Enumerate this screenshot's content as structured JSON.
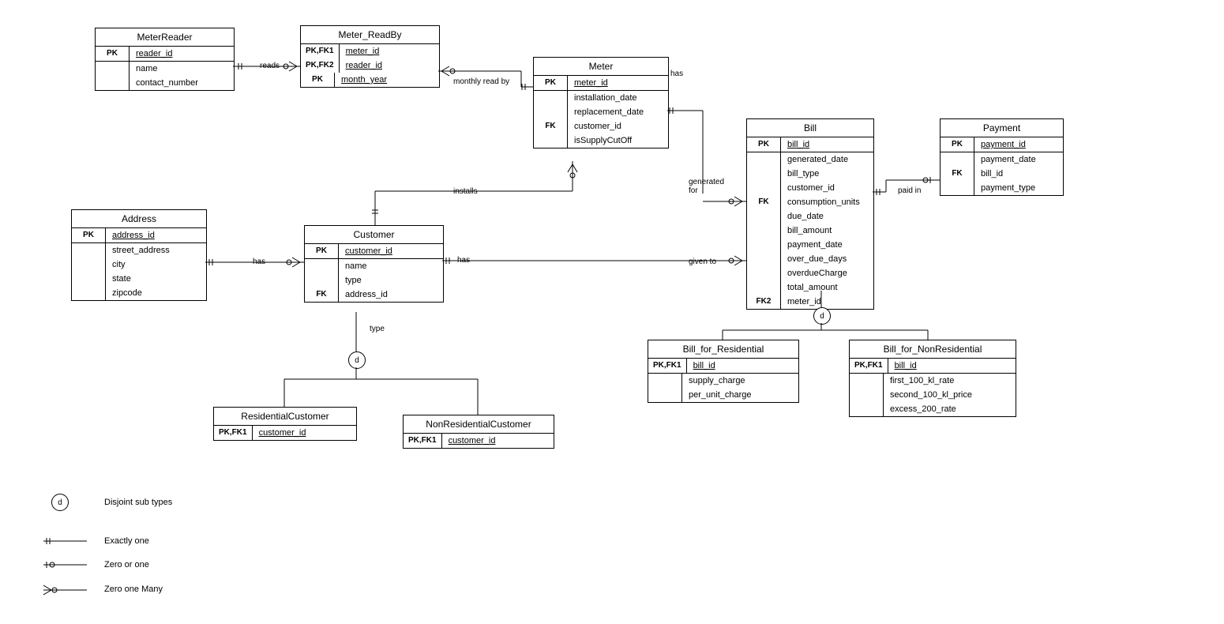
{
  "entities": {
    "meter_reader": {
      "title": "MeterReader",
      "rows": [
        {
          "key": "PK",
          "attr": "reader_id",
          "pk": true,
          "divider": true
        },
        {
          "key": "",
          "attr": "name",
          "pk": false
        },
        {
          "key": "",
          "attr": "contact_number",
          "pk": false
        }
      ]
    },
    "meter_readby": {
      "title": "Meter_ReadBy",
      "rows": [
        {
          "key": "PK,FK1",
          "attr": "meter_id",
          "pk": true
        },
        {
          "key": "PK,FK2",
          "attr": "reader_id",
          "pk": true
        },
        {
          "key": "PK",
          "attr": "month_year",
          "pk": true
        }
      ]
    },
    "meter": {
      "title": "Meter",
      "rows": [
        {
          "key": "PK",
          "attr": "meter_id",
          "pk": true,
          "divider": true
        },
        {
          "key": "",
          "attr": "installation_date",
          "pk": false
        },
        {
          "key": "",
          "attr": "replacement_date",
          "pk": false
        },
        {
          "key": "FK",
          "attr": "customer_id",
          "pk": false
        },
        {
          "key": "",
          "attr": "isSupplyCutOff",
          "pk": false
        }
      ]
    },
    "bill": {
      "title": "Bill",
      "rows": [
        {
          "key": "PK",
          "attr": "bill_id",
          "pk": true,
          "divider": true
        },
        {
          "key": "",
          "attr": "generated_date",
          "pk": false
        },
        {
          "key": "",
          "attr": "bill_type",
          "pk": false
        },
        {
          "key": "",
          "attr": "customer_id",
          "pk": false
        },
        {
          "key": "FK",
          "attr": "consumption_units",
          "pk": false
        },
        {
          "key": "",
          "attr": "due_date",
          "pk": false
        },
        {
          "key": "",
          "attr": "bill_amount",
          "pk": false
        },
        {
          "key": "",
          "attr": "payment_date",
          "pk": false
        },
        {
          "key": "",
          "attr": "over_due_days",
          "pk": false
        },
        {
          "key": "",
          "attr": "overdueCharge",
          "pk": false
        },
        {
          "key": "",
          "attr": "total_amount",
          "pk": false
        },
        {
          "key": "FK2",
          "attr": "meter_id",
          "pk": false
        }
      ]
    },
    "payment": {
      "title": "Payment",
      "rows": [
        {
          "key": "PK",
          "attr": "payment_id",
          "pk": true,
          "divider": true
        },
        {
          "key": "",
          "attr": "payment_date",
          "pk": false
        },
        {
          "key": "FK",
          "attr": "bill_id",
          "pk": false
        },
        {
          "key": "",
          "attr": "payment_type",
          "pk": false
        }
      ]
    },
    "address": {
      "title": "Address",
      "rows": [
        {
          "key": "PK",
          "attr": "address_id",
          "pk": true,
          "divider": true
        },
        {
          "key": "",
          "attr": "street_address",
          "pk": false
        },
        {
          "key": "",
          "attr": "city",
          "pk": false
        },
        {
          "key": "",
          "attr": "state",
          "pk": false
        },
        {
          "key": "",
          "attr": "zipcode",
          "pk": false
        }
      ]
    },
    "customer": {
      "title": "Customer",
      "rows": [
        {
          "key": "PK",
          "attr": "customer_id",
          "pk": true,
          "divider": true
        },
        {
          "key": "",
          "attr": "name",
          "pk": false
        },
        {
          "key": "",
          "attr": "type",
          "pk": false
        },
        {
          "key": "FK",
          "attr": "address_id",
          "pk": false
        }
      ]
    },
    "residential_customer": {
      "title": "ResidentialCustomer",
      "rows": [
        {
          "key": "PK,FK1",
          "attr": "customer_id",
          "pk": true
        }
      ]
    },
    "nonresidential_customer": {
      "title": "NonResidentialCustomer",
      "rows": [
        {
          "key": "PK,FK1",
          "attr": "customer_id",
          "pk": true
        }
      ]
    },
    "bill_residential": {
      "title": "Bill_for_Residential",
      "rows": [
        {
          "key": "PK,FK1",
          "attr": "bill_id",
          "pk": true,
          "divider": true
        },
        {
          "key": "",
          "attr": "supply_charge",
          "pk": false
        },
        {
          "key": "",
          "attr": "per_unit_charge",
          "pk": false
        }
      ]
    },
    "bill_nonresidential": {
      "title": "Bill_for_NonResidential",
      "rows": [
        {
          "key": "PK,FK1",
          "attr": "bill_id",
          "pk": true,
          "divider": true
        },
        {
          "key": "",
          "attr": "first_100_kl_rate",
          "pk": false
        },
        {
          "key": "",
          "attr": "second_100_kl_price",
          "pk": false
        },
        {
          "key": "",
          "attr": "excess_200_rate",
          "pk": false
        }
      ]
    }
  },
  "labels": {
    "reads": "reads",
    "monthly_read_by": "monthly read by",
    "has_meter": "has",
    "installs": "installs",
    "has_customer": "has",
    "has_address": "has",
    "generated_for": "generated for",
    "given_to": "given to",
    "paid_in": "paid in",
    "type": "type",
    "disjoint": "d",
    "legend_disjoint": "Disjoint sub types",
    "legend_exactly_one": "Exactly one",
    "legend_zero_or_one": "Zero or one",
    "legend_zero_one_many": "Zero one Many"
  }
}
